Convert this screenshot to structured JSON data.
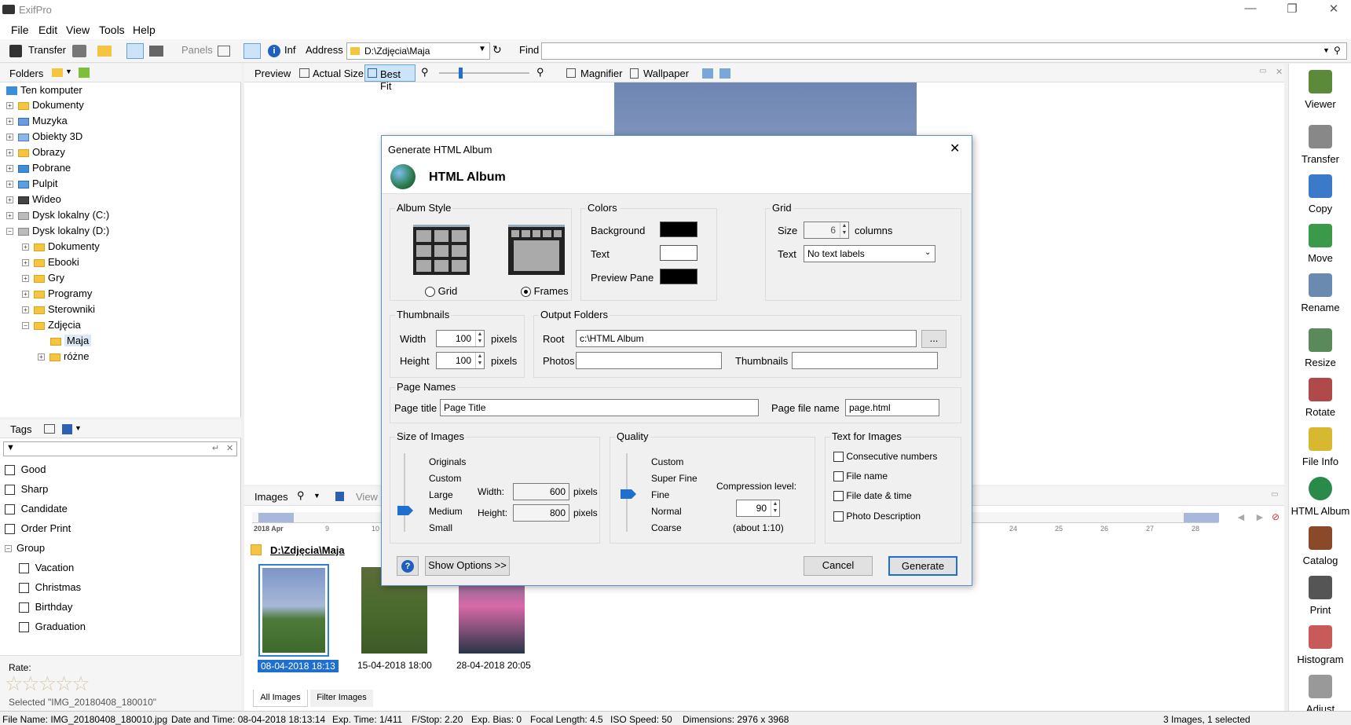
{
  "app": {
    "title": "ExifPro"
  },
  "menu": [
    "File",
    "Edit",
    "View",
    "Tools",
    "Help"
  ],
  "toolbar": {
    "transfer": "Transfer",
    "panels": "Panels",
    "info": "Inf",
    "address_label": "Address",
    "address_value": "D:\\Zdjęcia\\Maja",
    "find_label": "Find",
    "find_value": ""
  },
  "folders": {
    "header": "Folders",
    "items": [
      {
        "label": "Ten komputer"
      },
      {
        "label": "Dokumenty"
      },
      {
        "label": "Muzyka"
      },
      {
        "label": "Obiekty 3D"
      },
      {
        "label": "Obrazy"
      },
      {
        "label": "Pobrane"
      },
      {
        "label": "Pulpit"
      },
      {
        "label": "Wideo"
      },
      {
        "label": "Dysk lokalny (C:)"
      },
      {
        "label": "Dysk lokalny (D:)"
      },
      {
        "label": "Dokumenty"
      },
      {
        "label": "Ebooki"
      },
      {
        "label": "Gry"
      },
      {
        "label": "Programy"
      },
      {
        "label": "Sterowniki"
      },
      {
        "label": "Zdjęcia"
      },
      {
        "label": "Maja"
      },
      {
        "label": "różne"
      }
    ]
  },
  "tags": {
    "header": "Tags",
    "items": [
      "Good",
      "Sharp",
      "Candidate",
      "Order Print"
    ],
    "group_label": "Group",
    "group_items": [
      "Vacation",
      "Christmas",
      "Birthday",
      "Graduation"
    ],
    "rate_label": "Rate:",
    "selected": "Selected \"IMG_20180408_180010\""
  },
  "preview": {
    "label": "Preview",
    "actual_size": "Actual Size",
    "best_fit": "Best Fit",
    "magnifier": "Magnifier",
    "wallpaper": "Wallpaper"
  },
  "images": {
    "label": "Images",
    "view": "View",
    "timeline_year": "2018 Apr",
    "timeline_ticks": [
      "9",
      "10",
      "24",
      "25",
      "26",
      "27",
      "28"
    ],
    "folder_path": "D:\\Zdjęcia\\Maja",
    "thumbs": [
      {
        "caption": "08-04-2018  18:13",
        "selected": true
      },
      {
        "caption": "15-04-2018  18:00",
        "selected": false
      },
      {
        "caption": "28-04-2018  20:05",
        "selected": false
      }
    ],
    "tabs": [
      "All Images",
      "Filter Images"
    ]
  },
  "right_panel": [
    "Viewer",
    "Transfer",
    "Copy",
    "Move",
    "Rename",
    "Resize",
    "Rotate",
    "File Info",
    "HTML Album",
    "Catalog",
    "Print",
    "Histogram",
    "Adjust"
  ],
  "status": {
    "file_name": "File Name: IMG_20180408_180010.jpg",
    "date": "Date and Time: 08-04-2018 18:13:14",
    "exp": "Exp. Time: 1/411",
    "fstop": "F/Stop: 2.20",
    "bias": "Exp. Bias: 0",
    "focal": "Focal Length: 4.5",
    "iso": "ISO Speed: 50",
    "dims": "Dimensions: 2976 x 3968",
    "count": "3 Images, 1 selected"
  },
  "dialog": {
    "title": "Generate HTML Album",
    "heading": "HTML Album",
    "album_style": {
      "label": "Album Style",
      "grid": "Grid",
      "frames": "Frames",
      "selected": "Frames"
    },
    "colors": {
      "label": "Colors",
      "background": "Background",
      "text": "Text",
      "preview_pane": "Preview Pane",
      "background_color": "#000000",
      "text_color": "#ffffff",
      "preview_color": "#000000"
    },
    "grid": {
      "label": "Grid",
      "size_label": "Size",
      "size_value": "6",
      "columns": "columns",
      "text_label": "Text",
      "text_value": "No text labels"
    },
    "thumbnails": {
      "label": "Thumbnails",
      "width_label": "Width",
      "width_value": "100",
      "height_label": "Height",
      "height_value": "100",
      "pixels": "pixels"
    },
    "output": {
      "label": "Output Folders",
      "root_label": "Root",
      "root_value": "c:\\HTML Album",
      "browse": "...",
      "photos_label": "Photos",
      "photos_value": "",
      "thumbs_label": "Thumbnails",
      "thumbs_value": ""
    },
    "page_names": {
      "label": "Page Names",
      "title_label": "Page title",
      "title_value": "Page Title",
      "file_label": "Page file name",
      "file_value": "page.html"
    },
    "size_images": {
      "label": "Size of Images",
      "options": [
        "Originals",
        "Custom",
        "Large",
        "Medium",
        "Small"
      ],
      "selected": "Medium",
      "width_label": "Width:",
      "width_value": "600",
      "height_label": "Height:",
      "height_value": "800",
      "pixels": "pixels"
    },
    "quality": {
      "label": "Quality",
      "options": [
        "Custom",
        "Super Fine",
        "Fine",
        "Normal",
        "Coarse"
      ],
      "selected": "Fine",
      "compression_label": "Compression level:",
      "compression_value": "90",
      "about": "(about 1:10)"
    },
    "text_images": {
      "label": "Text for Images",
      "options": [
        "Consecutive numbers",
        "File name",
        "File date & time",
        "Photo Description"
      ]
    },
    "help": "?",
    "show_options": "Show Options >>",
    "cancel": "Cancel",
    "generate": "Generate"
  }
}
